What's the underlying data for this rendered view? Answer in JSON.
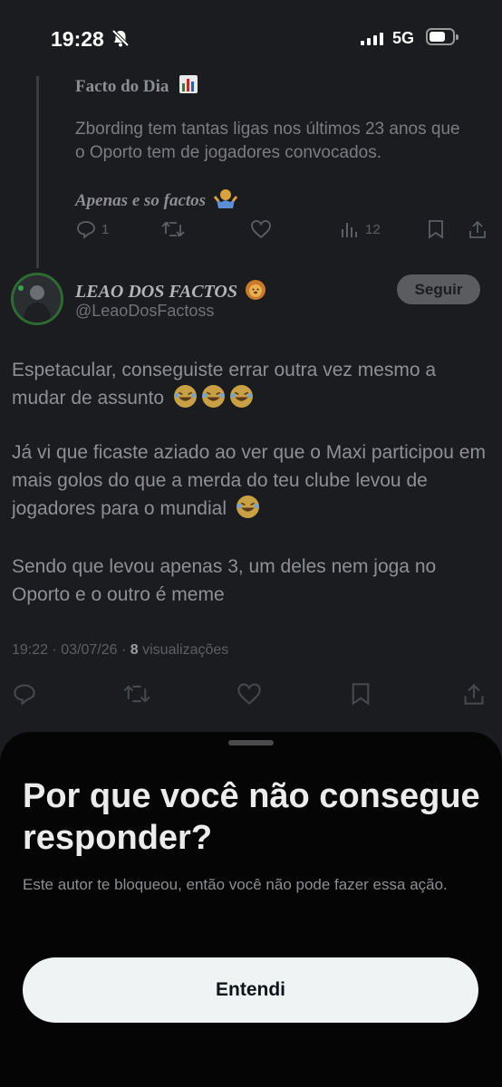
{
  "status_bar": {
    "time": "19:28",
    "network": "5G"
  },
  "quoted": {
    "title": "Facto do Dia",
    "body": "Zbording tem tantas ligas nos últimos 23 anos que o Oporto tem de jogadores convocados.",
    "ending": "Apenas e so factos",
    "reply_count": "1",
    "view_count": "12"
  },
  "post": {
    "author_name": "LEAO DOS FACTOS",
    "author_handle": "@LeaoDosFactoss",
    "follow_label": "Seguir",
    "paragraph_1": "Espetacular, conseguiste errar outra vez mesmo a mudar de assunto",
    "paragraph_2": "Já vi que ficaste aziado ao ver que o Maxi participou em mais golos do que a merda do teu clube levou de jogadores para o mundial",
    "paragraph_3": "Sendo que levou apenas 3, um deles nem joga no Oporto e o outro é meme",
    "timestamp": "19:22 · 03/07/26 · ",
    "views": "8",
    "views_label": " visualizações"
  },
  "sheet": {
    "title": "Por que você não consegue responder?",
    "message": "Este autor te bloqueou, então você não pode fazer essa ação.",
    "button_label": "Entendi"
  },
  "colors": {
    "background": "#1b1c1f",
    "sheet": "#050505",
    "button": "#eff3f4",
    "avatar_ring": "#2e6b32"
  },
  "icons": [
    "bell-slash-icon",
    "signal-icon",
    "battery-icon",
    "reply-icon",
    "retweet-icon",
    "like-icon",
    "views-icon",
    "bookmark-icon",
    "share-icon",
    "laughing-emoji-icon",
    "chart-emoji-icon",
    "shrug-emoji-icon",
    "lion-emoji-icon"
  ]
}
